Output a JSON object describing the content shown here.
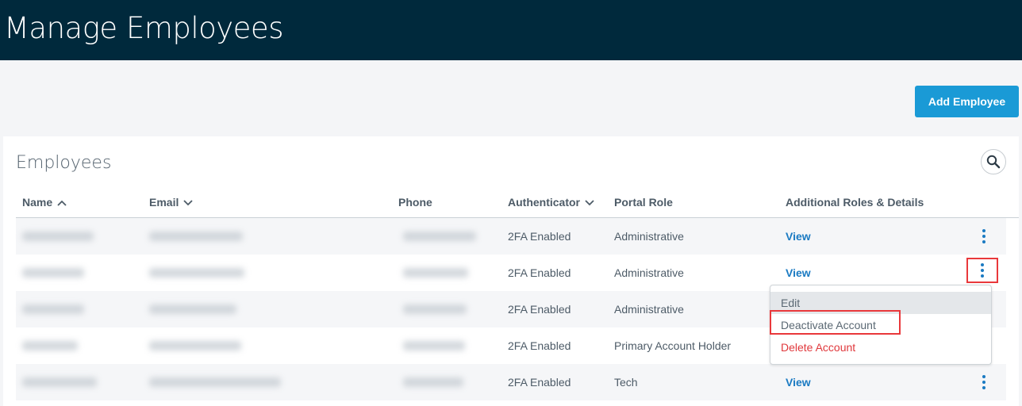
{
  "header": {
    "title": "Manage Employees"
  },
  "toolbar": {
    "add_label": "Add Employee"
  },
  "card": {
    "title": "Employees"
  },
  "columns": [
    {
      "label": "Name",
      "sort": "asc"
    },
    {
      "label": "Email",
      "sort": "desc"
    },
    {
      "label": "Phone"
    },
    {
      "label": "Authenticator",
      "sort": "desc"
    },
    {
      "label": "Portal Role"
    },
    {
      "label": "Additional Roles & Details"
    }
  ],
  "rows": [
    {
      "authenticator": "2FA Enabled",
      "role": "Administrative",
      "details": "View"
    },
    {
      "authenticator": "2FA Enabled",
      "role": "Administrative",
      "details": "View"
    },
    {
      "authenticator": "2FA Enabled",
      "role": "Administrative",
      "details": ""
    },
    {
      "authenticator": "2FA Enabled",
      "role": "Primary Account Holder",
      "details": ""
    },
    {
      "authenticator": "2FA Enabled",
      "role": "Tech",
      "details": "View"
    }
  ],
  "menu": {
    "items": [
      "Edit",
      "Deactivate Account",
      "Delete Account"
    ]
  },
  "colors": {
    "header": "#00293c",
    "accent": "#1a9ad6",
    "link": "#1a7ac2",
    "danger": "#e0383c",
    "highlight": "#e9383b"
  }
}
